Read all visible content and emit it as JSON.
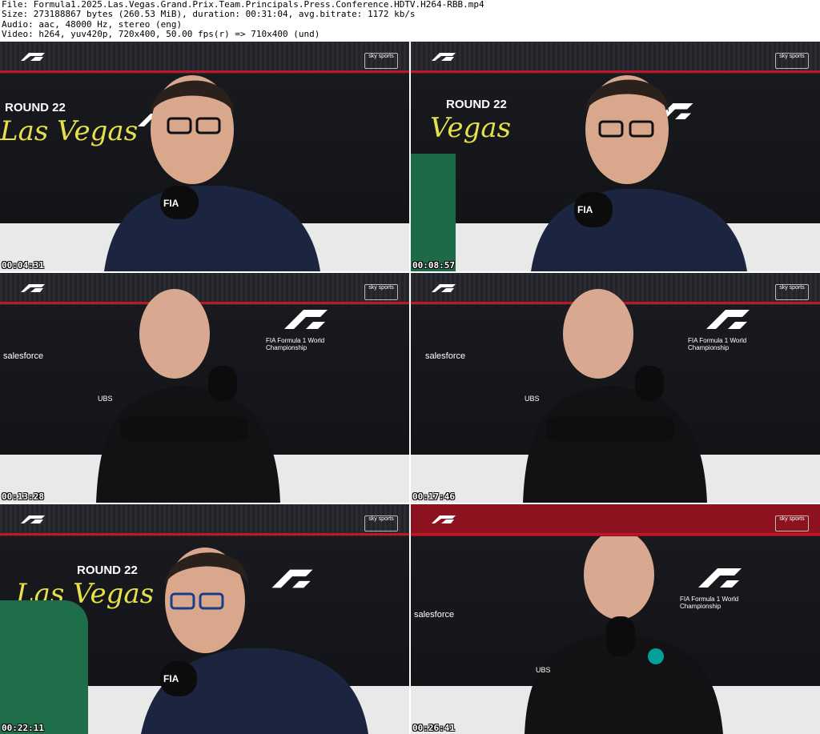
{
  "header": {
    "file_line": "File: Formula1.2025.Las.Vegas.Grand.Prix.Team.Principals.Press.Conference.HDTV.H264-RBB.mp4",
    "size_line": "Size: 273188867 bytes (260.53 MiB), duration: 00:31:04, avg.bitrate: 1172 kb/s",
    "audio_line": "Audio: aac, 48000 Hz, stereo (eng)",
    "video_line": "Video: h264, yuv420p, 720x400, 50.00 fps(r) => 710x400 (und)"
  },
  "thumbnails": [
    {
      "timestamp": "00:04:31",
      "round": "ROUND 22",
      "script": "Las Vegas",
      "brand": "sky sports"
    },
    {
      "timestamp": "00:08:57",
      "round": "ROUND 22",
      "script": "Vegas",
      "brand": "sky sports"
    },
    {
      "timestamp": "00:13:28",
      "sponsor": "salesforce",
      "fia": "FIA Formula 1 World Championship",
      "brand": "sky sports"
    },
    {
      "timestamp": "00:17:46",
      "sponsor": "salesforce",
      "fia": "FIA Formula 1 World Championship",
      "brand": "sky sports"
    },
    {
      "timestamp": "00:22:11",
      "round": "ROUND 22",
      "script": "Las Vegas",
      "brand": "sky sports"
    },
    {
      "timestamp": "00:26:41",
      "sponsor": "salesforce",
      "fia": "FIA Formula 1 World Championship",
      "brand": "sky sports"
    }
  ]
}
